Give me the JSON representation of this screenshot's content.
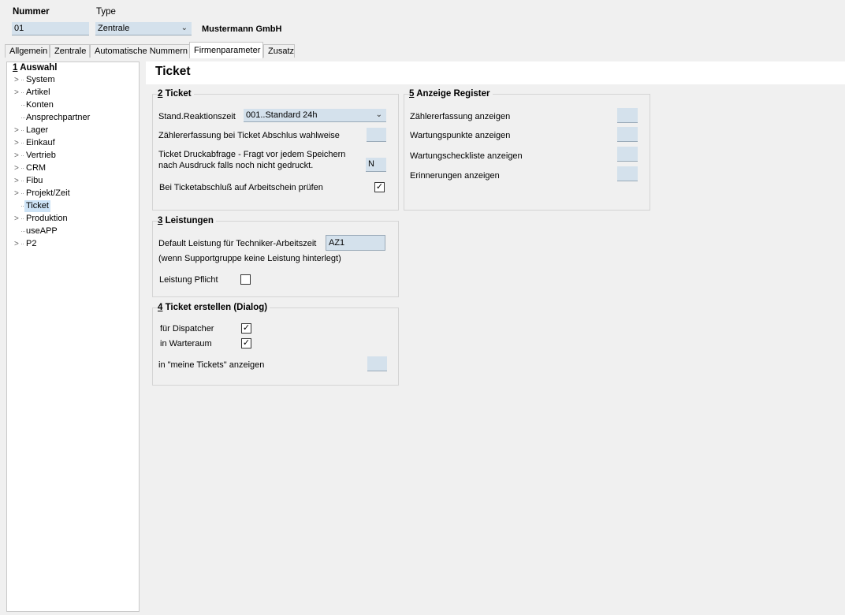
{
  "header": {
    "nummer_label": "Nummer",
    "nummer_value": "01",
    "type_label": "Type",
    "type_value": "Zentrale",
    "company": "Mustermann GmbH"
  },
  "tabs": [
    {
      "label": "Allgemein"
    },
    {
      "label": "Zentrale"
    },
    {
      "label": "Automatische Nummern"
    },
    {
      "label": "Firmenparameter"
    },
    {
      "label": "Zusatz"
    }
  ],
  "tree": {
    "root_num": "1",
    "root_label": "Auswahl",
    "items": [
      {
        "label": "System"
      },
      {
        "label": "Artikel"
      },
      {
        "label": "Konten"
      },
      {
        "label": "Ansprechpartner"
      },
      {
        "label": "Lager"
      },
      {
        "label": "Einkauf"
      },
      {
        "label": "Vertrieb"
      },
      {
        "label": "CRM"
      },
      {
        "label": "Fibu"
      },
      {
        "label": "Projekt/Zeit"
      },
      {
        "label": "Ticket"
      },
      {
        "label": "Produktion"
      },
      {
        "label": "useAPP"
      },
      {
        "label": "P2"
      }
    ]
  },
  "page_title": "Ticket",
  "ticket": {
    "num": "2",
    "title": "Ticket",
    "reaktionszeit_label": "Stand.Reaktionszeit",
    "reaktionszeit_value": "001..Standard 24h",
    "zaehler_label": "Zählererfassung bei Ticket Abschlus wahlweise",
    "zaehler_value": "",
    "druck_label_1": "Ticket Druckabfrage - Fragt vor jedem Speichern",
    "druck_label_2": "nach Ausdruck falls noch nicht gedruckt.",
    "druck_value": "N",
    "arbeitsschein_label": "Bei Ticketabschluß auf Arbeitschein prüfen",
    "arbeitsschein_checked": "✓"
  },
  "anzeige": {
    "num": "5",
    "title": "Anzeige Register",
    "zaehler": "Zählererfassung anzeigen",
    "wartungspunkte": "Wartungspunkte anzeigen",
    "checkliste": "Wartungscheckliste anzeigen",
    "erinnerungen": "Erinnerungen anzeigen"
  },
  "leistungen": {
    "num": "3",
    "title": "Leistungen",
    "default_label": "Default Leistung für Techniker-Arbeitszeit",
    "default_value": "AZ1",
    "hint": "(wenn Supportgruppe keine Leistung hinterlegt)",
    "pflicht_label": "Leistung Pflicht",
    "pflicht_checked": ""
  },
  "erstellen": {
    "num": "4",
    "title": "Ticket erstellen (Dialog)",
    "dispatcher_label": "für Dispatcher",
    "dispatcher_checked": "✓",
    "warteraum_label": "in Warteraum",
    "warteraum_checked": "✓",
    "meine_label": "in \"meine Tickets\" anzeigen"
  }
}
